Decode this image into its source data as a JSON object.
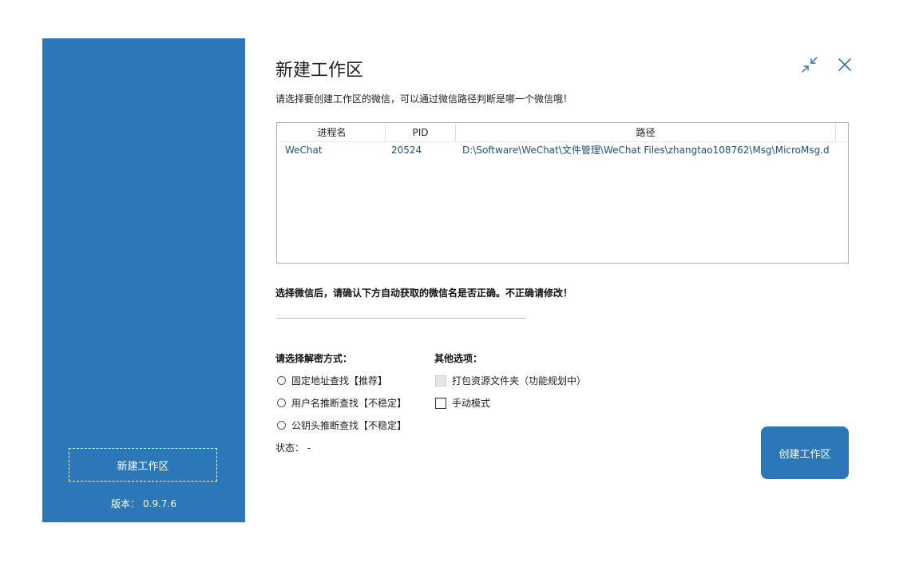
{
  "sidebar": {
    "new_workspace_label": "新建工作区",
    "version_label": "版本：",
    "version_value": "0.9.7.6",
    "bg_color": "#2b77b8"
  },
  "header": {
    "title": "新建工作区",
    "subtitle": "请选择要创建工作区的微信，可以通过微信路径判断是哪一个微信哦！",
    "icons": [
      "minimize-icon",
      "close-icon"
    ]
  },
  "process_table": {
    "columns": [
      "进程名",
      "PID",
      "路径"
    ],
    "rows": [
      {
        "name": "WeChat",
        "pid": "20524",
        "path": "D:\\Software\\WeChat\\文件管理\\WeChat Files\\zhangtao108762\\Msg\\MicroMsg.d"
      }
    ]
  },
  "wechat_name": {
    "instruction": "选择微信后，请确认下方自动获取的微信名是否正确。不正确请修改！",
    "value": ""
  },
  "decrypt": {
    "title": "请选择解密方式：",
    "options": [
      "固定地址查找【推荐】",
      "用户名推断查找【不稳定】",
      "公钥头推断查找【不稳定】"
    ]
  },
  "other": {
    "title": "其他选项：",
    "options": [
      "打包资源文件夹（功能规划中）",
      "手动模式"
    ]
  },
  "status": {
    "label": "状态：",
    "value": "-"
  },
  "create_button": {
    "label": "创建工作区"
  }
}
